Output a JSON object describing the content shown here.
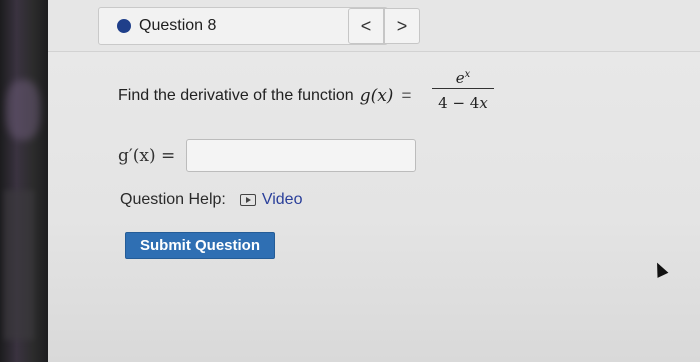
{
  "question_selector": {
    "label": "Question 8",
    "status_color": "#1f3f8a"
  },
  "nav": {
    "prev_symbol": "<",
    "next_symbol": ">"
  },
  "problem": {
    "prompt": "Find the derivative of the function",
    "function_lhs": "g(x)",
    "equals": "=",
    "numerator": "e",
    "numerator_exponent": "x",
    "denominator_constant": "4 − 4",
    "denominator_variable": "x"
  },
  "answer": {
    "label": "g′(x) =",
    "value": ""
  },
  "help": {
    "label": "Question Help:",
    "video_label": "Video"
  },
  "submit": {
    "label": "Submit Question"
  }
}
